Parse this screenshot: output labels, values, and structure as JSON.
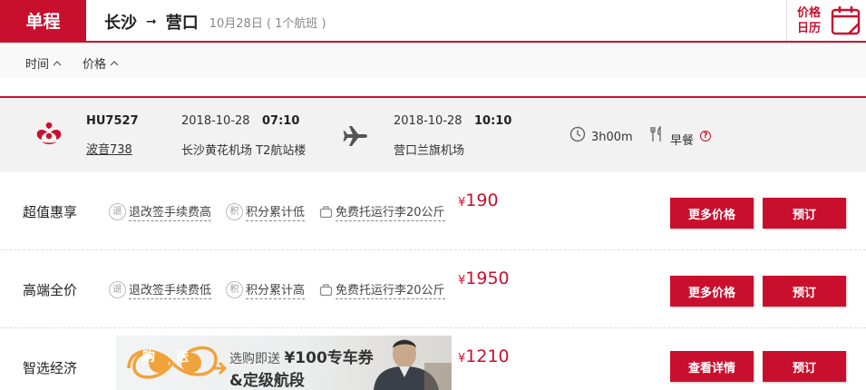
{
  "header": {
    "trip_type": "单程",
    "from_city": "长沙",
    "to_city": "营口",
    "date_info": "10月28日 ( 1个航班 )",
    "calendar_label": "价格日历"
  },
  "sort": {
    "time_label": "时间",
    "price_label": "价格"
  },
  "flight": {
    "number": "HU7527",
    "aircraft": "波音738",
    "dep_date": "2018-10-28",
    "dep_time": "07:10",
    "dep_airport": "长沙黄花机场 T2航站楼",
    "arr_date": "2018-10-28",
    "arr_time": "10:10",
    "arr_airport": "营口兰旗机场",
    "duration": "3h00m",
    "meal": "早餐",
    "help": "?"
  },
  "fares": [
    {
      "name": "超值惠享",
      "tag1_badge": "退",
      "tag1": "退改签手续费高",
      "tag2_badge": "积",
      "tag2": "积分累计低",
      "tag3": "免费托运行李20公斤",
      "currency": "¥",
      "price": "190",
      "btn1": "更多价格",
      "btn2": "预订"
    },
    {
      "name": "高端全价",
      "tag1_badge": "退",
      "tag1": "退改签手续费低",
      "tag2_badge": "积",
      "tag2": "积分累计高",
      "tag3": "免费托运行李20公斤",
      "currency": "¥",
      "price": "1950",
      "btn1": "更多价格",
      "btn2": "预订"
    },
    {
      "name": "智选经济",
      "promo_buy": "购",
      "promo_give": "送",
      "promo_line1_a": "选购即送",
      "promo_line1_b": "¥100专车券",
      "promo_line2": "&定级航段",
      "currency": "¥",
      "price": "1210",
      "btn1": "查看详情",
      "btn2": "预订"
    }
  ],
  "colors": {
    "brand_red": "#c8102e",
    "row_bg": "#f2f2f2",
    "promo_orange": "#f0a33a"
  }
}
